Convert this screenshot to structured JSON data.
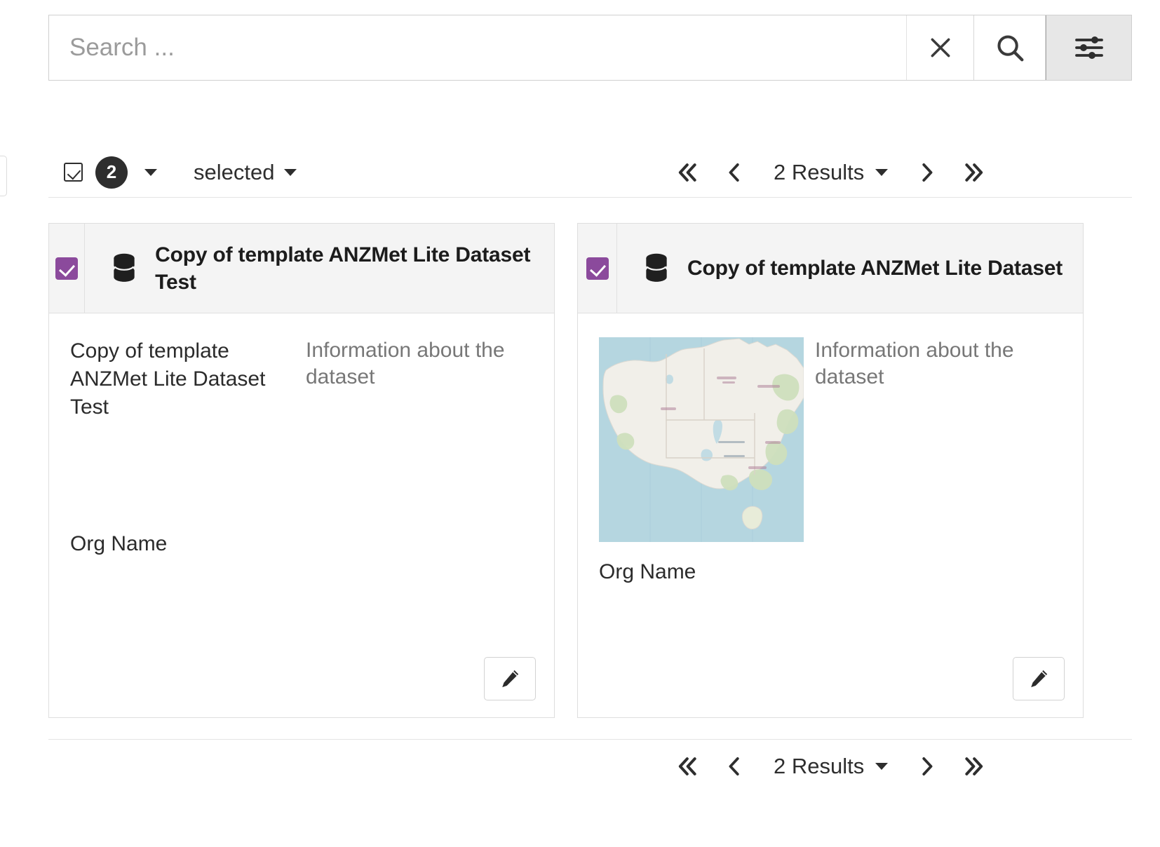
{
  "search": {
    "placeholder": "Search ...",
    "value": "",
    "clear_icon": "close-icon",
    "search_icon": "search-icon",
    "filter_icon": "sliders-filter-icon"
  },
  "toolbar": {
    "select_all_icon": "checkbox-checked-icon",
    "selected_count": "2",
    "count_caret_icon": "caret-down-icon",
    "selected_label": "selected",
    "selected_caret_icon": "caret-down-icon"
  },
  "pagination": {
    "first_icon": "chevron-double-left-icon",
    "prev_icon": "chevron-left-icon",
    "results_label": "2 Results",
    "results_caret_icon": "caret-down-icon",
    "next_icon": "chevron-right-icon",
    "last_icon": "chevron-double-right-icon"
  },
  "cards": [
    {
      "checkbox_checked": true,
      "type_icon": "database-icon",
      "title": "Copy of template ANZMet Lite Dataset Test",
      "record_title": "Copy of template ANZMet Lite Dataset Test",
      "abstract": "Information about the dataset",
      "org_name": "Org Name",
      "has_thumbnail": false,
      "edit_icon": "pencil-edit-icon"
    },
    {
      "checkbox_checked": true,
      "type_icon": "database-icon",
      "title": "Copy of template ANZMet Lite Dataset",
      "record_title": "",
      "abstract": "Information about the dataset",
      "org_name": "Org Name",
      "has_thumbnail": true,
      "thumbnail_alt": "map-thumbnail-australia",
      "edit_icon": "pencil-edit-icon"
    }
  ],
  "colors": {
    "accent_purple": "#8b4a9c",
    "badge_dark": "#2e2e2e",
    "card_header_bg": "#f4f4f4",
    "muted_text": "#777777",
    "map_ocean": "#b5d6e0",
    "map_land": "#f1efe9",
    "map_green": "#cfe0bd"
  }
}
